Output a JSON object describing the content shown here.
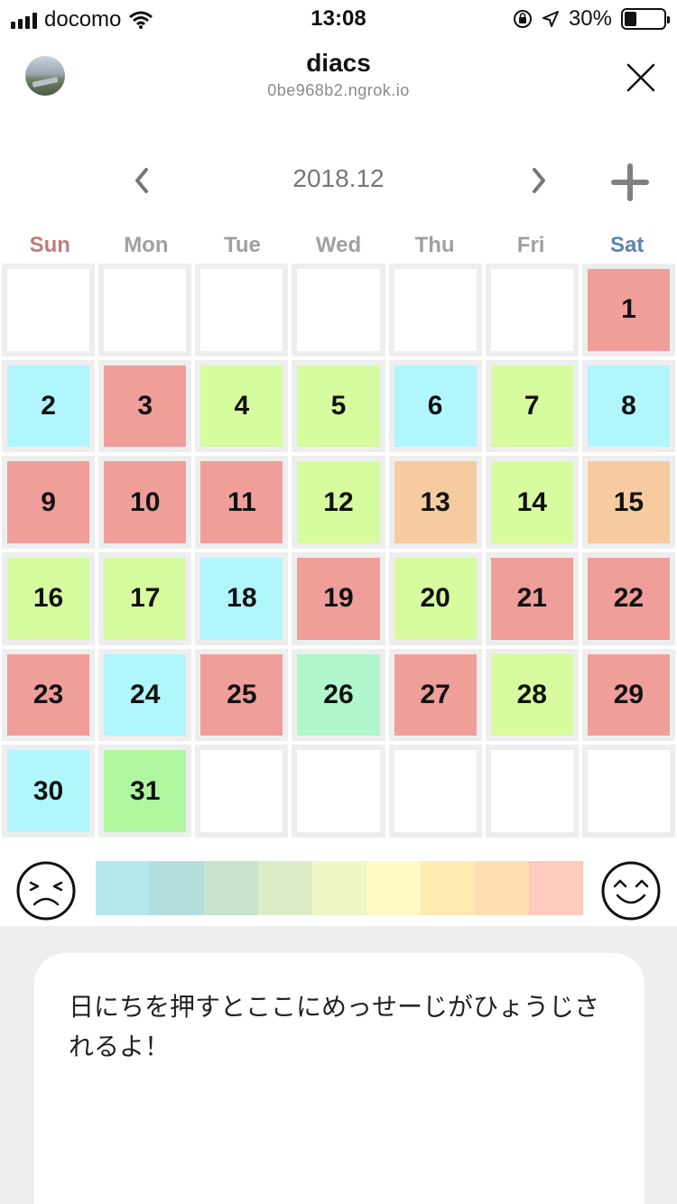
{
  "status_bar": {
    "carrier": "docomo",
    "time": "13:08",
    "battery": "30%",
    "battery_level": 0.3
  },
  "header": {
    "title": "diacs",
    "subtitle": "0be968b2.ngrok.io"
  },
  "calendar": {
    "month_label": "2018.12",
    "weekdays": [
      "Sun",
      "Mon",
      "Tue",
      "Wed",
      "Thu",
      "Fri",
      "Sat"
    ],
    "days": [
      {
        "label": "",
        "color": "#ffffff"
      },
      {
        "label": "",
        "color": "#ffffff"
      },
      {
        "label": "",
        "color": "#ffffff"
      },
      {
        "label": "",
        "color": "#ffffff"
      },
      {
        "label": "",
        "color": "#ffffff"
      },
      {
        "label": "",
        "color": "#ffffff"
      },
      {
        "label": "1",
        "color": "#ef9e9a"
      },
      {
        "label": "2",
        "color": "#b0f6fc"
      },
      {
        "label": "3",
        "color": "#ef9e9a"
      },
      {
        "label": "4",
        "color": "#d7fb9f"
      },
      {
        "label": "5",
        "color": "#d7fb9f"
      },
      {
        "label": "6",
        "color": "#b0f6fc"
      },
      {
        "label": "7",
        "color": "#d7fb9f"
      },
      {
        "label": "8",
        "color": "#b0f6fc"
      },
      {
        "label": "9",
        "color": "#ef9e9a"
      },
      {
        "label": "10",
        "color": "#ef9e9a"
      },
      {
        "label": "11",
        "color": "#ef9e9a"
      },
      {
        "label": "12",
        "color": "#d7fb9f"
      },
      {
        "label": "13",
        "color": "#f6cb9f"
      },
      {
        "label": "14",
        "color": "#d7fb9f"
      },
      {
        "label": "15",
        "color": "#f6cb9f"
      },
      {
        "label": "16",
        "color": "#d7fb9f"
      },
      {
        "label": "17",
        "color": "#d7fb9f"
      },
      {
        "label": "18",
        "color": "#b0f6fc"
      },
      {
        "label": "19",
        "color": "#ef9e9a"
      },
      {
        "label": "20",
        "color": "#d7fb9f"
      },
      {
        "label": "21",
        "color": "#ef9e9a"
      },
      {
        "label": "22",
        "color": "#ef9e9a"
      },
      {
        "label": "23",
        "color": "#ef9e9a"
      },
      {
        "label": "24",
        "color": "#b0f6fc"
      },
      {
        "label": "25",
        "color": "#ef9e9a"
      },
      {
        "label": "26",
        "color": "#b2f6cc"
      },
      {
        "label": "27",
        "color": "#ef9e9a"
      },
      {
        "label": "28",
        "color": "#d7fb9f"
      },
      {
        "label": "29",
        "color": "#ef9e9a"
      },
      {
        "label": "30",
        "color": "#b0f6fc"
      },
      {
        "label": "31",
        "color": "#aef79e"
      },
      {
        "label": "",
        "color": "#ffffff"
      },
      {
        "label": "",
        "color": "#ffffff"
      },
      {
        "label": "",
        "color": "#ffffff"
      },
      {
        "label": "",
        "color": "#ffffff"
      },
      {
        "label": "",
        "color": "#ffffff"
      }
    ]
  },
  "mood_scale": {
    "colors": [
      "#b4e6ee",
      "#b3dedc",
      "#c6e3cd",
      "#dcecc8",
      "#eef7c4",
      "#fff9c2",
      "#ffeab1",
      "#ffdeb0",
      "#ffcbbd"
    ]
  },
  "message": {
    "text": "日にちを押すとここにめっせーじがひょうじされるよ！"
  },
  "colors": {
    "sunday": "#c27b7b",
    "saturday": "#5e84b4",
    "weekday": "#a0a0a0"
  }
}
